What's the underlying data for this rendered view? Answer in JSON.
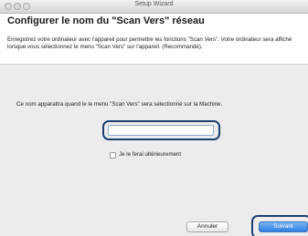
{
  "window": {
    "title": "Setup Wizard",
    "controls": [
      "close-button",
      "minimize-button",
      "zoom-button"
    ]
  },
  "header": {
    "title": "Configurer le nom du \"Scan Vers\" réseau",
    "description": "Enregistrez votre ordinateur avec l'appareil pour permettre les fonctions \"Scan Vers\". Votre ordinateur sera affiché lorsque vous sélectionnez le menu \"Scan Vers\" sur l'appareil. (Recommandé)."
  },
  "main": {
    "info_text": "Ce nom apparaitra quand le le menu \"Scan Vers\" sera sélectionné sur la Machine.",
    "name_field": {
      "value": "",
      "placeholder": ""
    },
    "checkbox": {
      "label": "Je le ferai ultérieurement",
      "checked": false
    }
  },
  "footer": {
    "cancel_label": "Annuler",
    "next_label": "Suivant"
  },
  "colors": {
    "highlight": "#1c3f70",
    "primary_button": "#2f7fe0",
    "background": "#ececec"
  }
}
